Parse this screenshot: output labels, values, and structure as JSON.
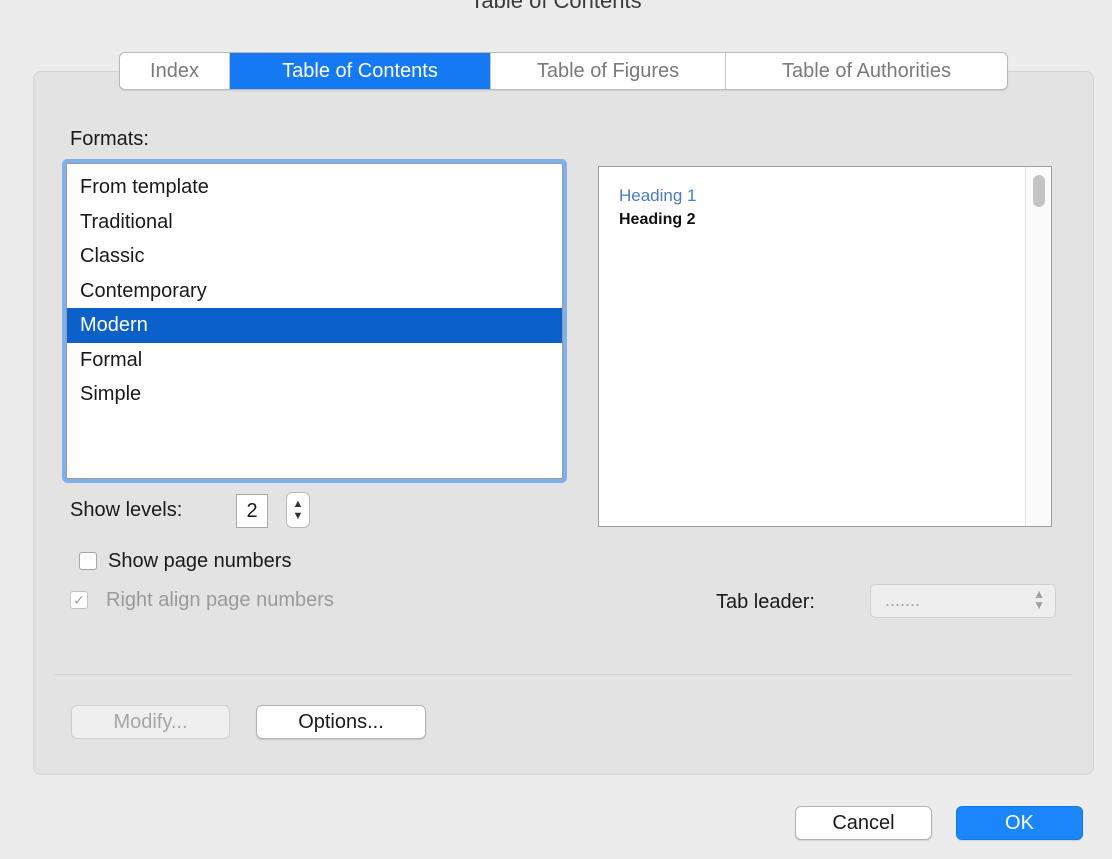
{
  "window": {
    "title": "Table of Contents"
  },
  "tabs": [
    {
      "label": "Index",
      "active": false
    },
    {
      "label": "Table of Contents",
      "active": true
    },
    {
      "label": "Table of Figures",
      "active": false
    },
    {
      "label": "Table of Authorities",
      "active": false
    }
  ],
  "formats": {
    "label": "Formats:",
    "items": [
      "From template",
      "Traditional",
      "Classic",
      "Contemporary",
      "Modern",
      "Formal",
      "Simple"
    ],
    "selected": "Modern"
  },
  "preview": {
    "heading1": "Heading 1",
    "heading2": "Heading 2"
  },
  "show_levels": {
    "label": "Show levels:",
    "value": "2"
  },
  "options": {
    "show_page_numbers": {
      "label": "Show page numbers",
      "checked": false
    },
    "right_align": {
      "label": "Right align page numbers",
      "checked": true,
      "disabled": true
    }
  },
  "tab_leader": {
    "label": "Tab leader:",
    "value": "......."
  },
  "buttons": {
    "modify": "Modify...",
    "options": "Options...",
    "cancel": "Cancel",
    "ok": "OK"
  },
  "colors": {
    "accent": "#1479f2",
    "selection": "#0b61c9",
    "heading1_preview": "#4a7bc4"
  },
  "icons": {
    "stepper": "up-down-stepper-icon",
    "select_chevron": "chevron-up-down-icon",
    "checkmark": "checkmark-icon"
  }
}
